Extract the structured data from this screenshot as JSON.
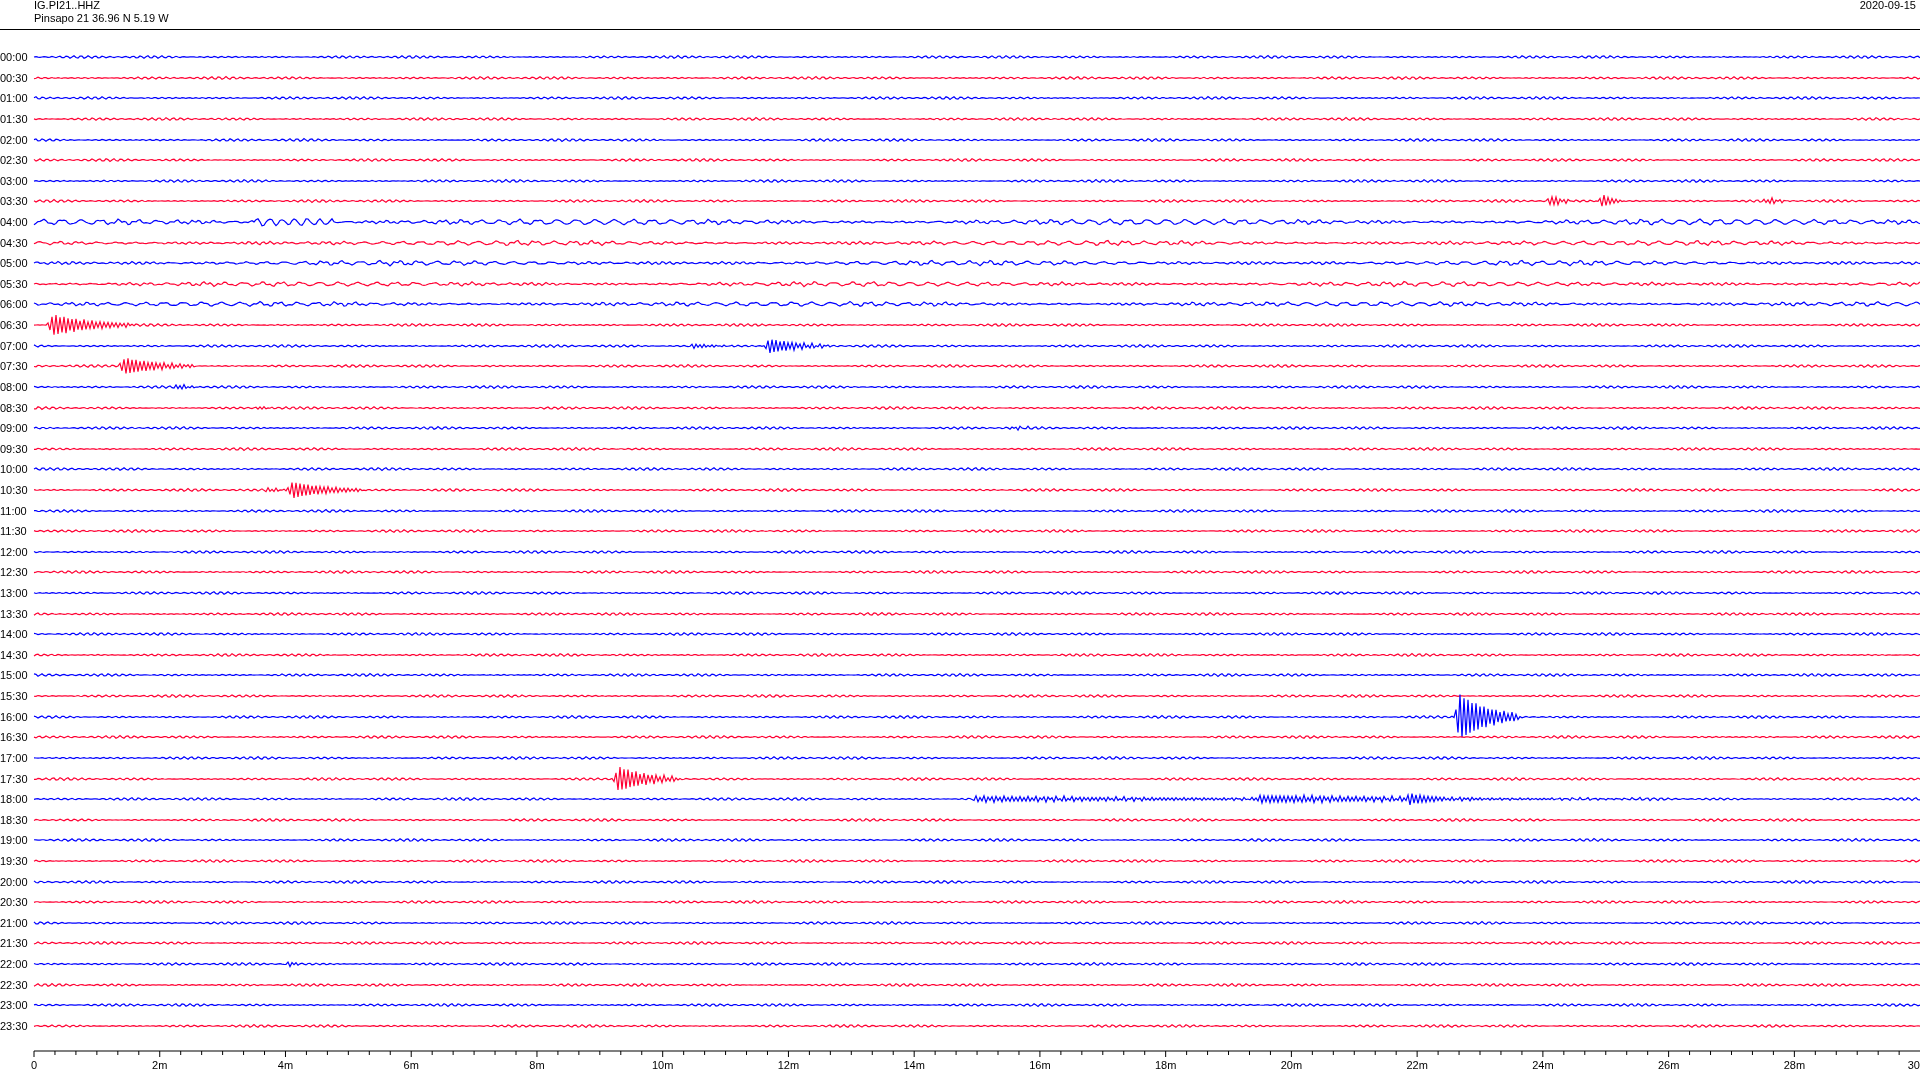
{
  "header": {
    "station": "IG.PI21..HHZ",
    "location": "Pinsapo 21  36.96 N 5.19 W",
    "date": "2020-09-15"
  },
  "rows": [
    {
      "label": "00:00",
      "color": "#0000ff"
    },
    {
      "label": "00:30",
      "color": "#ff0033"
    },
    {
      "label": "01:00",
      "color": "#0000ff"
    },
    {
      "label": "01:30",
      "color": "#ff0033"
    },
    {
      "label": "02:00",
      "color": "#0000ff"
    },
    {
      "label": "02:30",
      "color": "#ff0033"
    },
    {
      "label": "03:00",
      "color": "#0000ff"
    },
    {
      "label": "03:30",
      "color": "#ff0033"
    },
    {
      "label": "04:00",
      "color": "#0000ff"
    },
    {
      "label": "04:30",
      "color": "#ff0033"
    },
    {
      "label": "05:00",
      "color": "#0000ff"
    },
    {
      "label": "05:30",
      "color": "#ff0033"
    },
    {
      "label": "06:00",
      "color": "#0000ff"
    },
    {
      "label": "06:30",
      "color": "#ff0033"
    },
    {
      "label": "07:00",
      "color": "#0000ff"
    },
    {
      "label": "07:30",
      "color": "#ff0033"
    },
    {
      "label": "08:00",
      "color": "#0000ff"
    },
    {
      "label": "08:30",
      "color": "#ff0033"
    },
    {
      "label": "09:00",
      "color": "#0000ff"
    },
    {
      "label": "09:30",
      "color": "#ff0033"
    },
    {
      "label": "10:00",
      "color": "#0000ff"
    },
    {
      "label": "10:30",
      "color": "#ff0033"
    },
    {
      "label": "11:00",
      "color": "#0000ff"
    },
    {
      "label": "11:30",
      "color": "#ff0033"
    },
    {
      "label": "12:00",
      "color": "#0000ff"
    },
    {
      "label": "12:30",
      "color": "#ff0033"
    },
    {
      "label": "13:00",
      "color": "#0000ff"
    },
    {
      "label": "13:30",
      "color": "#ff0033"
    },
    {
      "label": "14:00",
      "color": "#0000ff"
    },
    {
      "label": "14:30",
      "color": "#ff0033"
    },
    {
      "label": "15:00",
      "color": "#0000ff"
    },
    {
      "label": "15:30",
      "color": "#ff0033"
    },
    {
      "label": "16:00",
      "color": "#0000ff"
    },
    {
      "label": "16:30",
      "color": "#ff0033"
    },
    {
      "label": "17:00",
      "color": "#0000ff"
    },
    {
      "label": "17:30",
      "color": "#ff0033"
    },
    {
      "label": "18:00",
      "color": "#0000ff"
    },
    {
      "label": "18:30",
      "color": "#ff0033"
    },
    {
      "label": "19:00",
      "color": "#0000ff"
    },
    {
      "label": "19:30",
      "color": "#ff0033"
    },
    {
      "label": "20:00",
      "color": "#0000ff"
    },
    {
      "label": "20:30",
      "color": "#ff0033"
    },
    {
      "label": "21:00",
      "color": "#0000ff"
    },
    {
      "label": "21:30",
      "color": "#ff0033"
    },
    {
      "label": "22:00",
      "color": "#0000ff"
    },
    {
      "label": "22:30",
      "color": "#ff0033"
    },
    {
      "label": "23:00",
      "color": "#0000ff"
    },
    {
      "label": "23:30",
      "color": "#ff0033"
    }
  ],
  "x_axis": {
    "labels": [
      "0",
      "2m",
      "4m",
      "6m",
      "8m",
      "10m",
      "12m",
      "14m",
      "16m",
      "18m",
      "20m",
      "22m",
      "24m",
      "26m",
      "28m",
      "30"
    ]
  }
}
